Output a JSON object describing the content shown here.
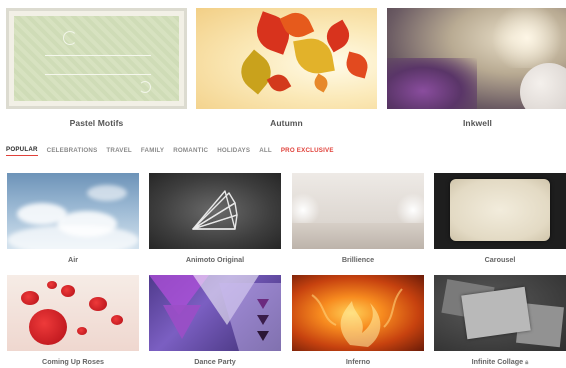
{
  "featured": [
    {
      "label": "Pastel Motifs"
    },
    {
      "label": "Autumn"
    },
    {
      "label": "Inkwell"
    }
  ],
  "tabs": [
    {
      "label": "POPULAR",
      "active": true
    },
    {
      "label": "CELEBRATIONS"
    },
    {
      "label": "TRAVEL"
    },
    {
      "label": "FAMILY"
    },
    {
      "label": "ROMANTIC"
    },
    {
      "label": "HOLIDAYS"
    },
    {
      "label": "ALL"
    },
    {
      "label": "PRO EXCLUSIVE",
      "pro": true
    }
  ],
  "themes": [
    {
      "label": "Air"
    },
    {
      "label": "Animoto Original"
    },
    {
      "label": "Brillience"
    },
    {
      "label": "Carousel"
    },
    {
      "label": "Coming Up Roses"
    },
    {
      "label": "Dance Party"
    },
    {
      "label": "Inferno"
    },
    {
      "label": "Infinite Collage",
      "lock_icon": "lock-icon"
    }
  ],
  "colors": {
    "accent": "#e0413a",
    "label_text": "#555555",
    "tab_text": "#8a8a8a"
  }
}
